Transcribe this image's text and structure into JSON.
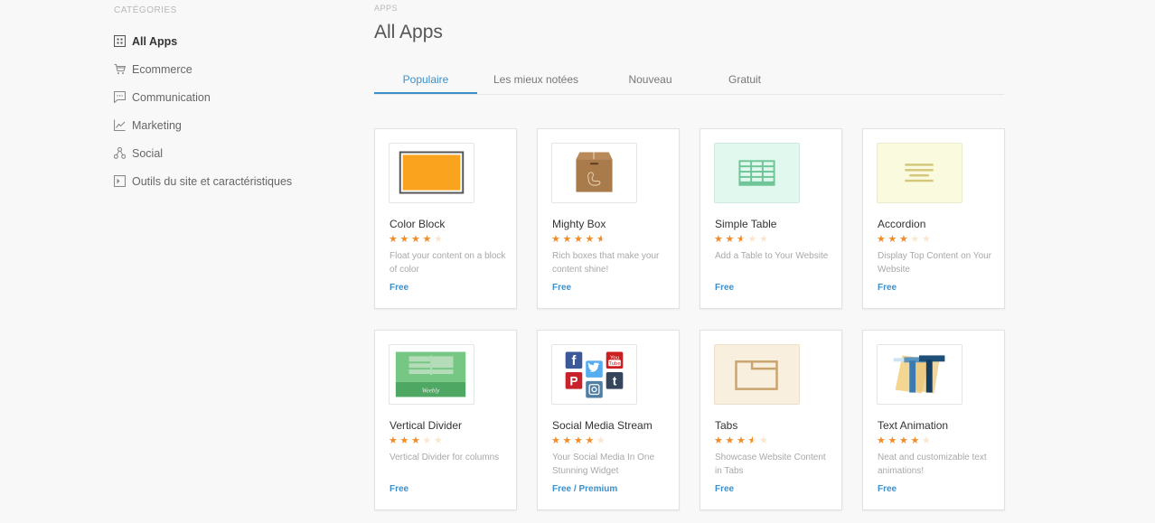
{
  "sidebar": {
    "heading": "CATÉGORIES",
    "items": [
      {
        "label": "All Apps",
        "icon": "grid-icon",
        "active": true
      },
      {
        "label": "Ecommerce",
        "icon": "cart-icon",
        "active": false
      },
      {
        "label": "Communication",
        "icon": "chat-icon",
        "active": false
      },
      {
        "label": "Marketing",
        "icon": "chart-icon",
        "active": false
      },
      {
        "label": "Social",
        "icon": "share-icon",
        "active": false
      },
      {
        "label": "Outils du site et caractéristiques",
        "icon": "tools-icon",
        "active": false
      }
    ]
  },
  "main": {
    "breadcrumb": "APPS",
    "title": "All Apps",
    "tabs": [
      {
        "label": "Populaire",
        "active": true
      },
      {
        "label": "Les mieux notées",
        "active": false
      },
      {
        "label": "Nouveau",
        "active": false
      },
      {
        "label": "Gratuit",
        "active": false
      }
    ],
    "apps": [
      {
        "name": "Color Block",
        "rating": 4,
        "description": "Float your content on a block of color",
        "price": "Free",
        "thumbnail": "color-block-thumbnail",
        "thumb_bg": "#ffffff"
      },
      {
        "name": "Mighty Box",
        "rating": 4.5,
        "description": "Rich boxes that make your content shine!",
        "price": "Free",
        "thumbnail": "box-thumbnail",
        "thumb_bg": "#ffffff"
      },
      {
        "name": "Simple Table",
        "rating": 2.5,
        "description": "Add a Table to Your Website",
        "price": "Free",
        "thumbnail": "table-thumbnail",
        "thumb_bg": "#e0f8ee"
      },
      {
        "name": "Accordion",
        "rating": 3,
        "description": "Display Top Content on Your Website",
        "price": "Free",
        "thumbnail": "accordion-thumbnail",
        "thumb_bg": "#fafadf"
      },
      {
        "name": "Vertical Divider",
        "rating": 3,
        "description": "Vertical Divider for columns",
        "price": "Free",
        "thumbnail": "divider-thumbnail",
        "thumb_bg": "#ffffff"
      },
      {
        "name": "Social Media Stream",
        "rating": 4,
        "description": "Your Social Media In One Stunning Widget",
        "price": "Free / Premium",
        "thumbnail": "social-thumbnail",
        "thumb_bg": "#ffffff"
      },
      {
        "name": "Tabs",
        "rating": 3.5,
        "description": "Showcase Website Content in Tabs",
        "price": "Free",
        "thumbnail": "tabs-thumbnail",
        "thumb_bg": "#f9efdf"
      },
      {
        "name": "Text Animation",
        "rating": 4,
        "description": "Neat and customizable text animations!",
        "price": "Free",
        "thumbnail": "text-animation-thumbnail",
        "thumb_bg": "#ffffff"
      }
    ]
  },
  "colors": {
    "accent": "#3d8fc9",
    "star": "#f08c2a",
    "star_empty": "#fbe6cf",
    "background": "#f8f8f8"
  }
}
